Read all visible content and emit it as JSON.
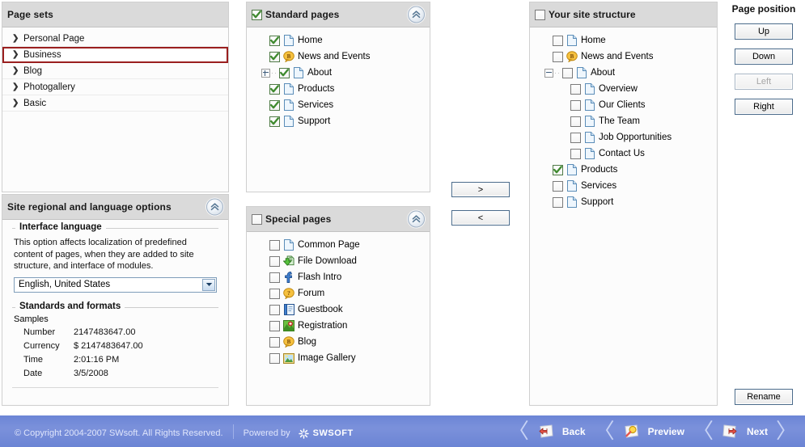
{
  "page_sets": {
    "title": "Page sets",
    "items": [
      {
        "label": "Personal Page",
        "selected": false
      },
      {
        "label": "Business",
        "selected": true
      },
      {
        "label": "Blog",
        "selected": false
      },
      {
        "label": "Photogallery",
        "selected": false
      },
      {
        "label": "Basic",
        "selected": false
      }
    ]
  },
  "regional": {
    "title": "Site regional and language options",
    "interface_language": {
      "legend": "Interface language",
      "help": "This option affects localization of predefined content of pages, when they are added to site structure, and interface of modules.",
      "value": "English, United States"
    },
    "standards": {
      "legend": "Standards and formats",
      "samples_label": "Samples",
      "rows": [
        {
          "key": "Number",
          "value": "2147483647.00"
        },
        {
          "key": "Currency",
          "value": "$ 2147483647.00"
        },
        {
          "key": "Time",
          "value": "2:01:16 PM"
        },
        {
          "key": "Date",
          "value": "3/5/2008"
        }
      ]
    }
  },
  "standard_pages": {
    "title": "Standard pages",
    "checked": true,
    "items": [
      {
        "label": "Home",
        "checked": true,
        "icon": "page-icon",
        "indent": 0,
        "expander": "none"
      },
      {
        "label": "News and Events",
        "checked": true,
        "icon": "blog-icon",
        "indent": 0,
        "expander": "none"
      },
      {
        "label": "About",
        "checked": true,
        "icon": "page-icon",
        "indent": 0,
        "expander": "plus"
      },
      {
        "label": "Products",
        "checked": true,
        "icon": "page-icon",
        "indent": 0,
        "expander": "none"
      },
      {
        "label": "Services",
        "checked": true,
        "icon": "page-icon",
        "indent": 0,
        "expander": "none"
      },
      {
        "label": "Support",
        "checked": true,
        "icon": "page-icon",
        "indent": 0,
        "expander": "none"
      }
    ]
  },
  "special_pages": {
    "title": "Special pages",
    "checked": false,
    "items": [
      {
        "label": "Common Page",
        "checked": false,
        "icon": "page-icon"
      },
      {
        "label": "File Download",
        "checked": false,
        "icon": "download-icon"
      },
      {
        "label": "Flash Intro",
        "checked": false,
        "icon": "flash-icon"
      },
      {
        "label": "Forum",
        "checked": false,
        "icon": "forum-icon"
      },
      {
        "label": "Guestbook",
        "checked": false,
        "icon": "guestbook-icon"
      },
      {
        "label": "Registration",
        "checked": false,
        "icon": "registration-icon"
      },
      {
        "label": "Blog",
        "checked": false,
        "icon": "blog-icon"
      },
      {
        "label": "Image Gallery",
        "checked": false,
        "icon": "gallery-icon"
      }
    ]
  },
  "site_structure": {
    "title": "Your site structure",
    "checked": false,
    "items": [
      {
        "label": "Home",
        "checked": false,
        "icon": "page-icon",
        "indent": 0,
        "expander": "none"
      },
      {
        "label": "News and Events",
        "checked": false,
        "icon": "blog-icon",
        "indent": 0,
        "expander": "none"
      },
      {
        "label": "About",
        "checked": false,
        "icon": "page-icon",
        "indent": 0,
        "expander": "minus"
      },
      {
        "label": "Overview",
        "checked": false,
        "icon": "page-icon",
        "indent": 1,
        "expander": "none"
      },
      {
        "label": "Our Clients",
        "checked": false,
        "icon": "page-icon",
        "indent": 1,
        "expander": "none"
      },
      {
        "label": "The Team",
        "checked": false,
        "icon": "page-icon",
        "indent": 1,
        "expander": "none"
      },
      {
        "label": "Job Opportunities",
        "checked": false,
        "icon": "page-icon",
        "indent": 1,
        "expander": "none"
      },
      {
        "label": "Contact Us",
        "checked": false,
        "icon": "page-icon",
        "indent": 1,
        "expander": "none"
      },
      {
        "label": "Products",
        "checked": true,
        "icon": "page-icon",
        "indent": 0,
        "expander": "none"
      },
      {
        "label": "Services",
        "checked": false,
        "icon": "page-icon",
        "indent": 0,
        "expander": "none"
      },
      {
        "label": "Support",
        "checked": false,
        "icon": "page-icon",
        "indent": 0,
        "expander": "none"
      }
    ]
  },
  "transfer": {
    "add_label": ">",
    "remove_label": "<"
  },
  "page_position": {
    "title": "Page position",
    "buttons": [
      {
        "label": "Up",
        "disabled": false
      },
      {
        "label": "Down",
        "disabled": false
      },
      {
        "label": "Left",
        "disabled": true
      },
      {
        "label": "Right",
        "disabled": false
      }
    ],
    "rename_label": "Rename"
  },
  "footer": {
    "copyright": "© Copyright 2004-2007 SWsoft. All Rights Reserved.",
    "powered_by": "Powered by",
    "brand": "SWSOFT",
    "nav": [
      {
        "label": "Back",
        "icon": "back-arrow-icon"
      },
      {
        "label": "Preview",
        "icon": "preview-magnifier-icon"
      },
      {
        "label": "Next",
        "icon": "next-arrow-icon"
      }
    ]
  },
  "colors": {
    "footer_blue": "#7b91db",
    "header_gray": "#dadada",
    "selection_red": "#9a1f1f",
    "check_green": "#3e8a2e"
  }
}
